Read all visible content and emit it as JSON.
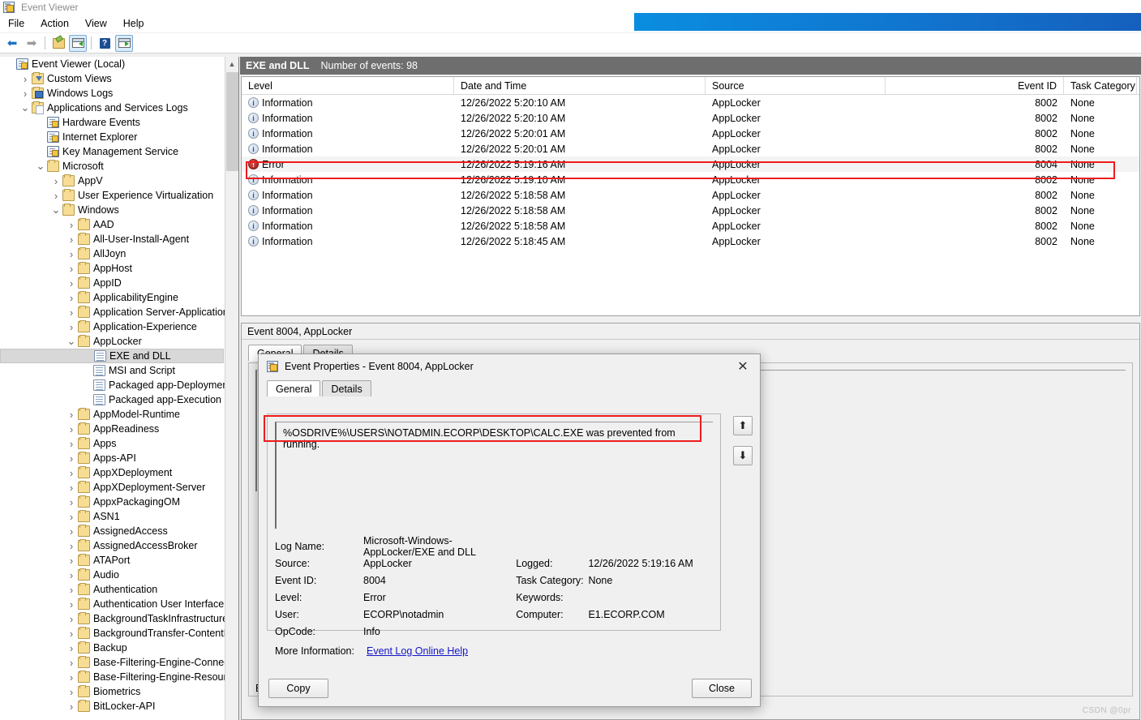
{
  "window": {
    "title": "Event Viewer",
    "app_icon": "event-viewer-icon"
  },
  "menubar": {
    "items": [
      {
        "label": "File"
      },
      {
        "label": "Action"
      },
      {
        "label": "View"
      },
      {
        "label": "Help"
      }
    ]
  },
  "toolbar": {
    "buttons": [
      {
        "name": "back-icon",
        "glyph": "←"
      },
      {
        "name": "forward-icon",
        "glyph": "→"
      },
      {
        "name": "open-folder-icon",
        "glyph": ""
      },
      {
        "name": "show-hide-console-tree-icon",
        "glyph": ""
      },
      {
        "name": "help-icon",
        "glyph": "?"
      },
      {
        "name": "show-hide-action-pane-icon",
        "glyph": ""
      }
    ]
  },
  "tree": {
    "root_label": "Event Viewer (Local)",
    "items": [
      {
        "label": "Event Viewer (Local)",
        "indent": 0,
        "twist": "none",
        "icon": "ico-ev",
        "selected": false
      },
      {
        "label": "Custom Views",
        "indent": 1,
        "twist": "collapsed",
        "icon": "ico-cview",
        "selected": false
      },
      {
        "label": "Windows Logs",
        "indent": 1,
        "twist": "collapsed",
        "icon": "ico-wlogs",
        "selected": false
      },
      {
        "label": "Applications and Services Logs",
        "indent": 1,
        "twist": "expanded",
        "icon": "ico-apps",
        "selected": false
      },
      {
        "label": "Hardware Events",
        "indent": 2,
        "twist": "none",
        "icon": "ico-ev",
        "selected": false
      },
      {
        "label": "Internet Explorer",
        "indent": 2,
        "twist": "none",
        "icon": "ico-ev",
        "selected": false
      },
      {
        "label": "Key Management Service",
        "indent": 2,
        "twist": "none",
        "icon": "ico-ev",
        "selected": false
      },
      {
        "label": "Microsoft",
        "indent": 2,
        "twist": "expanded",
        "icon": "ico-folder",
        "selected": false
      },
      {
        "label": "AppV",
        "indent": 3,
        "twist": "collapsed",
        "icon": "ico-folder",
        "selected": false
      },
      {
        "label": "User Experience Virtualization",
        "indent": 3,
        "twist": "collapsed",
        "icon": "ico-folder",
        "selected": false
      },
      {
        "label": "Windows",
        "indent": 3,
        "twist": "expanded",
        "icon": "ico-folder",
        "selected": false
      },
      {
        "label": "AAD",
        "indent": 4,
        "twist": "collapsed",
        "icon": "ico-folder",
        "selected": false
      },
      {
        "label": "All-User-Install-Agent",
        "indent": 4,
        "twist": "collapsed",
        "icon": "ico-folder",
        "selected": false
      },
      {
        "label": "AllJoyn",
        "indent": 4,
        "twist": "collapsed",
        "icon": "ico-folder",
        "selected": false
      },
      {
        "label": "AppHost",
        "indent": 4,
        "twist": "collapsed",
        "icon": "ico-folder",
        "selected": false
      },
      {
        "label": "AppID",
        "indent": 4,
        "twist": "collapsed",
        "icon": "ico-folder",
        "selected": false
      },
      {
        "label": "ApplicabilityEngine",
        "indent": 4,
        "twist": "collapsed",
        "icon": "ico-folder",
        "selected": false
      },
      {
        "label": "Application Server-Applications",
        "indent": 4,
        "twist": "collapsed",
        "icon": "ico-folder",
        "selected": false
      },
      {
        "label": "Application-Experience",
        "indent": 4,
        "twist": "collapsed",
        "icon": "ico-folder",
        "selected": false
      },
      {
        "label": "AppLocker",
        "indent": 4,
        "twist": "expanded",
        "icon": "ico-folder",
        "selected": false
      },
      {
        "label": "EXE and DLL",
        "indent": 5,
        "twist": "none",
        "icon": "ico-log",
        "selected": true
      },
      {
        "label": "MSI and Script",
        "indent": 5,
        "twist": "none",
        "icon": "ico-log",
        "selected": false
      },
      {
        "label": "Packaged app-Deployment",
        "indent": 5,
        "twist": "none",
        "icon": "ico-log",
        "selected": false
      },
      {
        "label": "Packaged app-Execution",
        "indent": 5,
        "twist": "none",
        "icon": "ico-log",
        "selected": false
      },
      {
        "label": "AppModel-Runtime",
        "indent": 4,
        "twist": "collapsed",
        "icon": "ico-folder",
        "selected": false
      },
      {
        "label": "AppReadiness",
        "indent": 4,
        "twist": "collapsed",
        "icon": "ico-folder",
        "selected": false
      },
      {
        "label": "Apps",
        "indent": 4,
        "twist": "collapsed",
        "icon": "ico-folder",
        "selected": false
      },
      {
        "label": "Apps-API",
        "indent": 4,
        "twist": "collapsed",
        "icon": "ico-folder",
        "selected": false
      },
      {
        "label": "AppXDeployment",
        "indent": 4,
        "twist": "collapsed",
        "icon": "ico-folder",
        "selected": false
      },
      {
        "label": "AppXDeployment-Server",
        "indent": 4,
        "twist": "collapsed",
        "icon": "ico-folder",
        "selected": false
      },
      {
        "label": "AppxPackagingOM",
        "indent": 4,
        "twist": "collapsed",
        "icon": "ico-folder",
        "selected": false
      },
      {
        "label": "ASN1",
        "indent": 4,
        "twist": "collapsed",
        "icon": "ico-folder",
        "selected": false
      },
      {
        "label": "AssignedAccess",
        "indent": 4,
        "twist": "collapsed",
        "icon": "ico-folder",
        "selected": false
      },
      {
        "label": "AssignedAccessBroker",
        "indent": 4,
        "twist": "collapsed",
        "icon": "ico-folder",
        "selected": false
      },
      {
        "label": "ATAPort",
        "indent": 4,
        "twist": "collapsed",
        "icon": "ico-folder",
        "selected": false
      },
      {
        "label": "Audio",
        "indent": 4,
        "twist": "collapsed",
        "icon": "ico-folder",
        "selected": false
      },
      {
        "label": "Authentication",
        "indent": 4,
        "twist": "collapsed",
        "icon": "ico-folder",
        "selected": false
      },
      {
        "label": "Authentication User Interface",
        "indent": 4,
        "twist": "collapsed",
        "icon": "ico-folder",
        "selected": false
      },
      {
        "label": "BackgroundTaskInfrastructure",
        "indent": 4,
        "twist": "collapsed",
        "icon": "ico-folder",
        "selected": false
      },
      {
        "label": "BackgroundTransfer-ContentPref",
        "indent": 4,
        "twist": "collapsed",
        "icon": "ico-folder",
        "selected": false
      },
      {
        "label": "Backup",
        "indent": 4,
        "twist": "collapsed",
        "icon": "ico-folder",
        "selected": false
      },
      {
        "label": "Base-Filtering-Engine-Connectio",
        "indent": 4,
        "twist": "collapsed",
        "icon": "ico-folder",
        "selected": false
      },
      {
        "label": "Base-Filtering-Engine-Resource-I",
        "indent": 4,
        "twist": "collapsed",
        "icon": "ico-folder",
        "selected": false
      },
      {
        "label": "Biometrics",
        "indent": 4,
        "twist": "collapsed",
        "icon": "ico-folder",
        "selected": false
      },
      {
        "label": "BitLocker-API",
        "indent": 4,
        "twist": "collapsed",
        "icon": "ico-folder",
        "selected": false
      }
    ]
  },
  "log_header": {
    "name": "EXE and DLL",
    "count_label": "Number of events: 98"
  },
  "event_list": {
    "columns": [
      "Level",
      "Date and Time",
      "Source",
      "Event ID",
      "Task Category"
    ],
    "rows": [
      {
        "level": "Information",
        "level_icon": "info-icon",
        "datetime": "12/26/2022 5:20:10 AM",
        "source": "AppLocker",
        "event_id": "8002",
        "task_category": "None",
        "annotated": false
      },
      {
        "level": "Information",
        "level_icon": "info-icon",
        "datetime": "12/26/2022 5:20:10 AM",
        "source": "AppLocker",
        "event_id": "8002",
        "task_category": "None",
        "annotated": false
      },
      {
        "level": "Information",
        "level_icon": "info-icon",
        "datetime": "12/26/2022 5:20:01 AM",
        "source": "AppLocker",
        "event_id": "8002",
        "task_category": "None",
        "annotated": false
      },
      {
        "level": "Information",
        "level_icon": "info-icon",
        "datetime": "12/26/2022 5:20:01 AM",
        "source": "AppLocker",
        "event_id": "8002",
        "task_category": "None",
        "annotated": false
      },
      {
        "level": "Error",
        "level_icon": "error-icon",
        "datetime": "12/26/2022 5:19:16 AM",
        "source": "AppLocker",
        "event_id": "8004",
        "task_category": "None",
        "annotated": true
      },
      {
        "level": "Information",
        "level_icon": "info-icon",
        "datetime": "12/26/2022 5:19:10 AM",
        "source": "AppLocker",
        "event_id": "8002",
        "task_category": "None",
        "annotated": false
      },
      {
        "level": "Information",
        "level_icon": "info-icon",
        "datetime": "12/26/2022 5:18:58 AM",
        "source": "AppLocker",
        "event_id": "8002",
        "task_category": "None",
        "annotated": false
      },
      {
        "level": "Information",
        "level_icon": "info-icon",
        "datetime": "12/26/2022 5:18:58 AM",
        "source": "AppLocker",
        "event_id": "8002",
        "task_category": "None",
        "annotated": false
      },
      {
        "level": "Information",
        "level_icon": "info-icon",
        "datetime": "12/26/2022 5:18:58 AM",
        "source": "AppLocker",
        "event_id": "8002",
        "task_category": "None",
        "annotated": false
      },
      {
        "level": "Information",
        "level_icon": "info-icon",
        "datetime": "12/26/2022 5:18:45 AM",
        "source": "AppLocker",
        "event_id": "8002",
        "task_category": "None",
        "annotated": false
      }
    ]
  },
  "preview_pane": {
    "title": "Event 8004, AppLocker",
    "tabs": [
      {
        "label": "General",
        "active": true
      },
      {
        "label": "Details",
        "active": false
      }
    ],
    "message": "%OSDRIVE%\\USERS\\NOTADMIN.ECORP\\DESKTOP\\CALC.EXE was prevented from running.",
    "footer": {
      "event_id_label": "Event ID:",
      "event_id_value": "8004",
      "task_category_label": "Task Category:",
      "task_category_value": "None"
    }
  },
  "dialog": {
    "title": "Event Properties - Event 8004, AppLocker",
    "close_glyph": "✕",
    "tabs": [
      {
        "label": "General",
        "active": true
      },
      {
        "label": "Details",
        "active": false
      }
    ],
    "message": "%OSDRIVE%\\USERS\\NOTADMIN.ECORP\\DESKTOP\\CALC.EXE was prevented from running.",
    "fields": [
      {
        "label1": "Log Name:",
        "value1": "Microsoft-Windows-AppLocker/EXE and DLL",
        "label2": "",
        "value2": ""
      },
      {
        "label1": "Source:",
        "value1": "AppLocker",
        "label2": "Logged:",
        "value2": "12/26/2022 5:19:16 AM"
      },
      {
        "label1": "Event ID:",
        "value1": "8004",
        "label2": "Task Category:",
        "value2": "None"
      },
      {
        "label1": "Level:",
        "value1": "Error",
        "label2": "Keywords:",
        "value2": ""
      },
      {
        "label1": "User:",
        "value1": "ECORP\\notadmin",
        "label2": "Computer:",
        "value2": "E1.ECORP.COM"
      },
      {
        "label1": "OpCode:",
        "value1": "Info",
        "label2": "",
        "value2": ""
      }
    ],
    "more_info_label": "More Information:",
    "more_info_link": "Event Log Online Help",
    "nav_up_glyph": "⬆",
    "nav_down_glyph": "⬇",
    "copy_button": "Copy",
    "close_button": "Close"
  },
  "annotations": {
    "accent_color": "#ee1c1c",
    "censor_bar_color": "#1175cf"
  },
  "watermark": "CSDN @0pr"
}
